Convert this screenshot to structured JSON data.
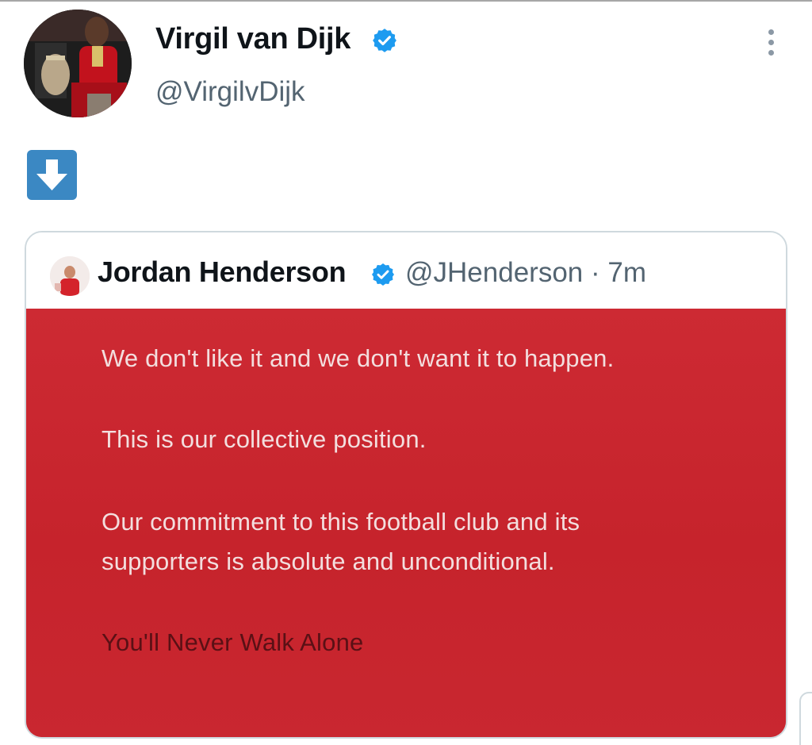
{
  "tweet": {
    "author": {
      "display_name": "Virgil van Dijk",
      "handle": "@VirgilvDijk",
      "verified": true,
      "avatar_icon": "profile-photo"
    },
    "more_icon": "more-vertical-icon",
    "body_emoji": {
      "name": "down-arrow-button-emoji",
      "color": "#3b88c3"
    },
    "quoted_tweet": {
      "author": {
        "display_name": "Jordan Henderson",
        "handle": "@JHenderson",
        "verified": true,
        "meta": "@JHenderson · 7m"
      },
      "time": "7m",
      "media": {
        "background_color": "#c8242d",
        "lines": {
          "line1": "We don't like it and we don't want it to happen.",
          "line2": "This is our collective position.",
          "line3": "Our commitment to this football club and its",
          "line4": "supporters is absolute and unconditional.",
          "signoff": "You'll Never Walk Alone"
        }
      }
    }
  },
  "colors": {
    "verified_badge": "#1d9bf0",
    "secondary_text": "#536471",
    "card_border": "#cfd9de"
  }
}
